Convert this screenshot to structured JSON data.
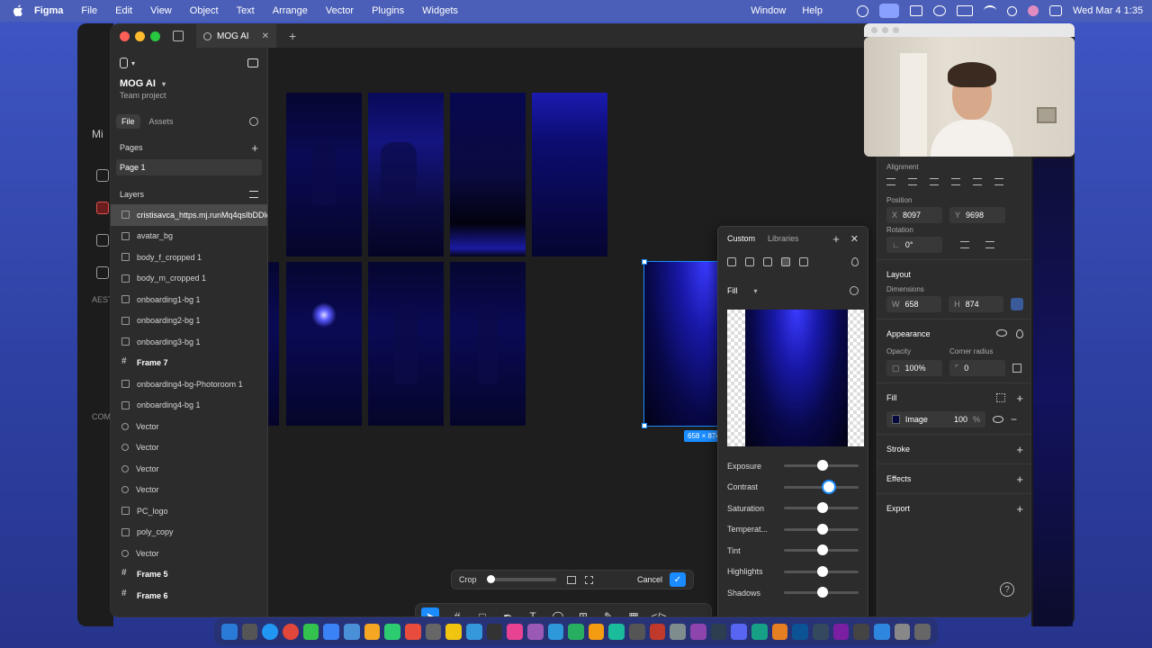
{
  "menubar": {
    "app": "Figma",
    "items": [
      "File",
      "Edit",
      "View",
      "Object",
      "Text",
      "Arrange",
      "Vector",
      "Plugins",
      "Widgets"
    ],
    "right_items": [
      "Window",
      "Help"
    ],
    "clock": "Wed Mar 4  1:35"
  },
  "tab": {
    "title": "MOG AI"
  },
  "project": {
    "name": "MOG AI",
    "subtitle": "Team project"
  },
  "left_tabs": {
    "file": "File",
    "assets": "Assets"
  },
  "pages": {
    "header": "Pages",
    "items": [
      "Page 1"
    ]
  },
  "layers": {
    "header": "Layers",
    "items": [
      {
        "name": "cristisavca_https.mj.runMq4qsIbDDlo",
        "type": "image",
        "selected": true
      },
      {
        "name": "avatar_bg",
        "type": "image"
      },
      {
        "name": "body_f_cropped 1",
        "type": "image"
      },
      {
        "name": "body_m_cropped 1",
        "type": "image"
      },
      {
        "name": "onboarding1-bg 1",
        "type": "image"
      },
      {
        "name": "onboarding2-bg 1",
        "type": "image"
      },
      {
        "name": "onboarding3-bg 1",
        "type": "image"
      },
      {
        "name": "Frame 7",
        "type": "frame"
      },
      {
        "name": "onboarding4-bg-Photoroom 1",
        "type": "image"
      },
      {
        "name": "onboarding4-bg 1",
        "type": "image"
      },
      {
        "name": "Vector",
        "type": "vector"
      },
      {
        "name": "Vector",
        "type": "vector"
      },
      {
        "name": "Vector",
        "type": "vector"
      },
      {
        "name": "Vector",
        "type": "vector"
      },
      {
        "name": "PC_logo",
        "type": "image"
      },
      {
        "name": "poly_copy",
        "type": "image"
      },
      {
        "name": "Vector",
        "type": "vector"
      },
      {
        "name": "Frame 5",
        "type": "frame"
      },
      {
        "name": "Frame 6",
        "type": "frame"
      }
    ]
  },
  "canvas": {
    "selection_size": "658 × 874"
  },
  "crop_bar": {
    "crop": "Crop",
    "cancel": "Cancel",
    "confirm": "✓",
    "zoom_level": 0
  },
  "popover": {
    "tabs": [
      "Custom",
      "Libraries"
    ],
    "fill_mode": "Fill",
    "adjustments": [
      {
        "label": "Exposure",
        "value": 0
      },
      {
        "label": "Contrast",
        "value": 0.15
      },
      {
        "label": "Saturation",
        "value": 0
      },
      {
        "label": "Temperat...",
        "value": 0
      },
      {
        "label": "Tint",
        "value": 0
      },
      {
        "label": "Highlights",
        "value": 0
      },
      {
        "label": "Shadows",
        "value": 0
      }
    ]
  },
  "right_panel": {
    "alignment": "Alignment",
    "position": "Position",
    "x_key": "X",
    "x": "8097",
    "y_key": "Y",
    "y": "9698",
    "rotation_label": "Rotation",
    "rotation": "0°",
    "layout": "Layout",
    "dimensions": "Dimensions",
    "w_key": "W",
    "w": "658",
    "h_key": "H",
    "h": "874",
    "appearance": "Appearance",
    "opacity_label": "Opacity",
    "opacity": "100%",
    "radius_label": "Corner radius",
    "radius": "0",
    "fill": "Fill",
    "fill_type": "Image",
    "fill_opacity": "100",
    "fill_pct": "%",
    "stroke": "Stroke",
    "effects": "Effects",
    "export": "Export",
    "help": "?"
  },
  "bg_window": {
    "labels": [
      "Mi",
      "AEST",
      "COM"
    ]
  },
  "colors": {
    "accent": "#1a8cff",
    "panel": "#2c2c2c",
    "canvas": "#1e1e1e"
  }
}
